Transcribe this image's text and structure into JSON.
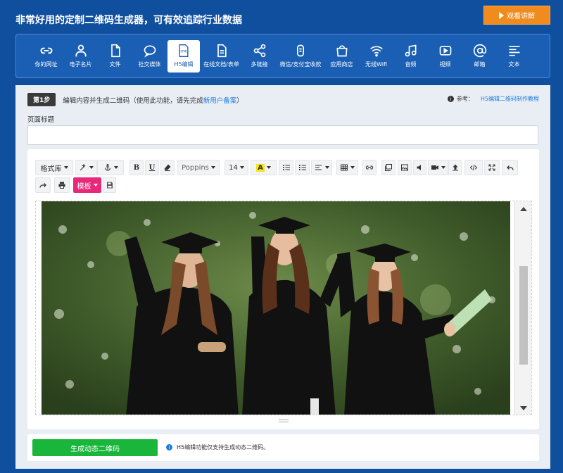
{
  "header": {
    "headline": "非常好用的定制二维码生成器，可有效追踪行业数据",
    "watch_button": "观看讲解"
  },
  "nav": {
    "items": [
      {
        "label": "你的网址",
        "icon": "link-icon"
      },
      {
        "label": "电子名片",
        "icon": "person-icon"
      },
      {
        "label": "文件",
        "icon": "file-icon"
      },
      {
        "label": "社交媒体",
        "icon": "chat-bubble-icon"
      },
      {
        "label": "H5编辑",
        "icon": "html-icon",
        "active": true
      },
      {
        "label": "在线文档/表单",
        "icon": "document-icon"
      },
      {
        "label": "多链接",
        "icon": "share-icon"
      },
      {
        "label": "微信/支付宝收款",
        "icon": "payment-icon"
      },
      {
        "label": "应用商店",
        "icon": "store-icon"
      },
      {
        "label": "无线Wifi",
        "icon": "wifi-icon"
      },
      {
        "label": "音频",
        "icon": "music-icon"
      },
      {
        "label": "视频",
        "icon": "video-icon"
      },
      {
        "label": "邮箱",
        "icon": "at-icon"
      },
      {
        "label": "文本",
        "icon": "text-lines-icon"
      }
    ]
  },
  "step": {
    "badge": "第1步",
    "text": "编辑内容并生成二维码（使用此功能，请先完成",
    "link": "新用户备案",
    "text_end": "）",
    "ref_label": "参考：",
    "ref_link": "H5编辑二维码制作教程"
  },
  "page_title": {
    "label": "页面标题",
    "value": ""
  },
  "toolbar": {
    "format_lib": "格式库",
    "bold": "B",
    "underline": "U",
    "font": "Poppins",
    "size": "14",
    "highlight": "A",
    "template": "模板"
  },
  "footer": {
    "generate_button": "生成动态二维码",
    "note": "H5编辑功能仅支持生成动态二维码。"
  },
  "colors": {
    "background": "#0f4f9e",
    "accent_orange": "#f08c1e",
    "generate_green": "#19b63b",
    "template_pink": "#e8297b",
    "link_blue": "#1e7be0"
  }
}
